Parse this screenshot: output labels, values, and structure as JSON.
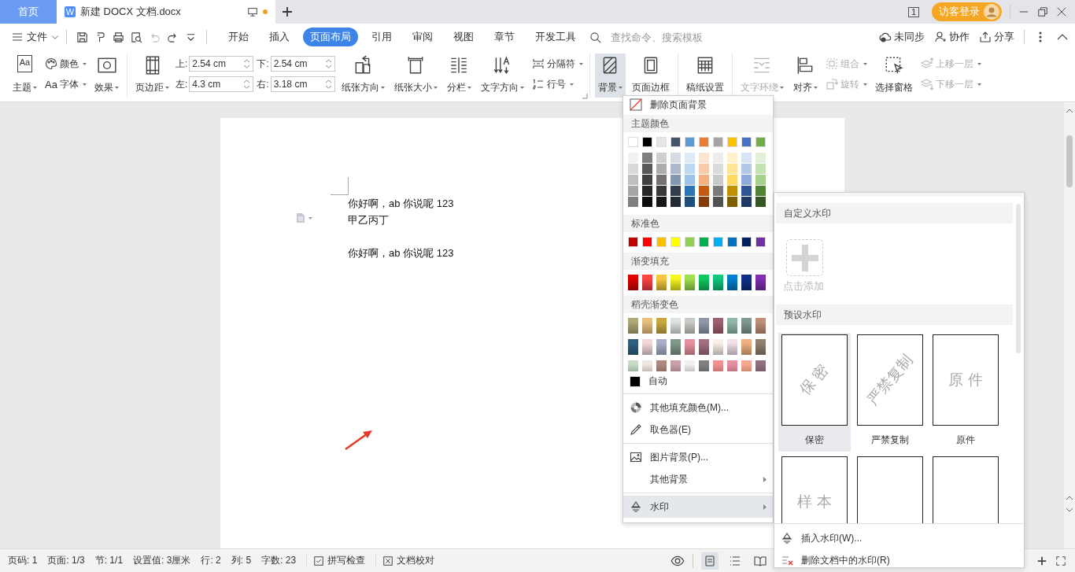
{
  "title_bar": {
    "tabs": [
      {
        "label": "首页",
        "kind": "home",
        "selected": false
      },
      {
        "label": "新建 DOCX 文档.docx",
        "kind": "document",
        "badge": "W",
        "unsaved": true,
        "selected": true
      }
    ],
    "window_count": "1",
    "login_button": "访客登录"
  },
  "menu_bar": {
    "file_menu": "文件",
    "tabs": [
      {
        "label": "开始",
        "selected": false
      },
      {
        "label": "插入",
        "selected": false
      },
      {
        "label": "页面布局",
        "selected": true
      },
      {
        "label": "引用",
        "selected": false
      },
      {
        "label": "审阅",
        "selected": false
      },
      {
        "label": "视图",
        "selected": false
      },
      {
        "label": "章节",
        "selected": false
      },
      {
        "label": "开发工具",
        "selected": false
      }
    ],
    "search": {
      "placeholder": "查找命令、搜索模板"
    },
    "actions": [
      "未同步",
      "协作",
      "分享"
    ]
  },
  "ribbon": {
    "groups": [
      [
        {
          "kind": "large",
          "items": [
            {
              "label": "主题",
              "icon_text": "Aa",
              "caret": true
            }
          ]
        },
        {
          "kind": "stack",
          "items": [
            {
              "label": "颜色",
              "caret": true
            },
            {
              "label": "字体",
              "icon_text": "Aa",
              "caret": true
            }
          ]
        },
        {
          "kind": "large",
          "items": [
            {
              "label": "效果",
              "caret": true
            }
          ]
        }
      ],
      [
        {
          "kind": "large",
          "items": [
            {
              "label": "页边距",
              "caret": true
            }
          ]
        },
        {
          "kind": "fields",
          "items": [
            {
              "label": "上:",
              "value": "2.54 cm"
            },
            {
              "label": "左:",
              "value": "4.3 cm"
            }
          ]
        },
        {
          "kind": "fields",
          "items": [
            {
              "label": "下:",
              "value": "2.54 cm"
            },
            {
              "label": "右:",
              "value": "3.18 cm"
            }
          ]
        },
        {
          "kind": "large",
          "items": [
            {
              "label": "纸张方向",
              "caret": true
            }
          ]
        },
        {
          "kind": "large",
          "items": [
            {
              "label": "纸张大小",
              "caret": true
            }
          ]
        },
        {
          "kind": "large",
          "items": [
            {
              "label": "分栏",
              "caret": true
            }
          ]
        },
        {
          "kind": "large",
          "items": [
            {
              "label": "文字方向",
              "caret": true
            }
          ]
        },
        {
          "kind": "stack",
          "items": [
            {
              "label": "分隔符",
              "caret": true
            },
            {
              "label": "行号",
              "caret": true
            }
          ]
        }
      ],
      [
        {
          "kind": "large",
          "items": [
            {
              "label": "背景",
              "caret": true,
              "selected": true
            }
          ]
        },
        {
          "kind": "large",
          "items": [
            {
              "label": "页面边框",
              "caret": false,
              "selected": false
            }
          ]
        }
      ],
      [
        {
          "kind": "large",
          "items": [
            {
              "label": "稿纸设置",
              "caret": false
            }
          ]
        }
      ],
      [
        {
          "kind": "large",
          "items": [
            {
              "label": "文字环绕",
              "caret": true,
              "disabled": true
            }
          ]
        },
        {
          "kind": "large",
          "items": [
            {
              "label": "对齐",
              "caret": true,
              "disabled": false
            }
          ]
        },
        {
          "kind": "stack",
          "items": [
            {
              "label": "组合",
              "caret": true,
              "disabled": true
            },
            {
              "label": "旋转",
              "caret": true,
              "disabled": true
            }
          ]
        },
        {
          "kind": "large",
          "items": [
            {
              "label": "选择窗格",
              "caret": false,
              "disabled": false
            }
          ]
        },
        {
          "kind": "stack",
          "items": [
            {
              "label": "上移一层",
              "caret": true,
              "disabled": true
            },
            {
              "label": "下移一层",
              "caret": true,
              "disabled": true
            }
          ]
        }
      ]
    ]
  },
  "document": {
    "blocks": [
      {
        "lines": [
          "你好啊，ab 你说呢 123",
          "甲乙丙丁"
        ]
      },
      {
        "lines": [
          "你好啊，ab 你说呢 123"
        ]
      }
    ]
  },
  "background_menu": {
    "remove": "删除页面背景",
    "theme_title": "主题颜色",
    "theme_colors": [
      {
        "color": "#ffffff",
        "shades": [
          {
            "color": "#f2f2f2"
          },
          {
            "color": "#d9d9d9"
          },
          {
            "color": "#bfbfbf"
          },
          {
            "color": "#a6a6a6"
          },
          {
            "color": "#808080"
          }
        ]
      },
      {
        "color": "#000000",
        "shades": [
          {
            "color": "#7f7f7f"
          },
          {
            "color": "#595959"
          },
          {
            "color": "#404040"
          },
          {
            "color": "#262626"
          },
          {
            "color": "#0d0d0d"
          }
        ]
      },
      {
        "color": "#e7e6e6",
        "shades": [
          {
            "color": "#d0cece"
          },
          {
            "color": "#aeabab"
          },
          {
            "color": "#757171"
          },
          {
            "color": "#3b3838"
          },
          {
            "color": "#181717"
          }
        ]
      },
      {
        "color": "#44546a",
        "shades": [
          {
            "color": "#d6dce4"
          },
          {
            "color": "#adb9ca"
          },
          {
            "color": "#8497b0"
          },
          {
            "color": "#333f4f"
          },
          {
            "color": "#222a35"
          }
        ]
      },
      {
        "color": "#5b9bd5",
        "shades": [
          {
            "color": "#deebf6"
          },
          {
            "color": "#bdd7ee"
          },
          {
            "color": "#9dc3e6"
          },
          {
            "color": "#2e75b5"
          },
          {
            "color": "#1e4e79"
          }
        ]
      },
      {
        "color": "#ed7d31",
        "shades": [
          {
            "color": "#fbe5d5"
          },
          {
            "color": "#f8cbad"
          },
          {
            "color": "#f4b183"
          },
          {
            "color": "#c55a11"
          },
          {
            "color": "#843c0c"
          }
        ]
      },
      {
        "color": "#a5a5a5",
        "shades": [
          {
            "color": "#ededed"
          },
          {
            "color": "#dbdbdb"
          },
          {
            "color": "#c9c9c9"
          },
          {
            "color": "#7b7b7b"
          },
          {
            "color": "#525252"
          }
        ]
      },
      {
        "color": "#ffc000",
        "shades": [
          {
            "color": "#fff2cc"
          },
          {
            "color": "#fee599"
          },
          {
            "color": "#ffd965"
          },
          {
            "color": "#bf9000"
          },
          {
            "color": "#7f6000"
          }
        ]
      },
      {
        "color": "#4472c4",
        "shades": [
          {
            "color": "#dae3f3"
          },
          {
            "color": "#b4c7e7"
          },
          {
            "color": "#8faadc"
          },
          {
            "color": "#2f5597"
          },
          {
            "color": "#203864"
          }
        ]
      },
      {
        "color": "#70ad47",
        "shades": [
          {
            "color": "#e2efd9"
          },
          {
            "color": "#c5e0b3"
          },
          {
            "color": "#a8d08d"
          },
          {
            "color": "#538135"
          },
          {
            "color": "#375623"
          }
        ]
      }
    ],
    "standard_title": "标准色",
    "standard_colors": [
      {
        "color": "#c00000"
      },
      {
        "color": "#ff0000"
      },
      {
        "color": "#ffc000"
      },
      {
        "color": "#ffff00"
      },
      {
        "color": "#92d050"
      },
      {
        "color": "#00b050"
      },
      {
        "color": "#00b0f0"
      },
      {
        "color": "#0070c0"
      },
      {
        "color": "#002060"
      },
      {
        "color": "#7030a0"
      }
    ],
    "gradient_title": "渐变填充",
    "gradients": [
      {
        "color": "#e00000"
      },
      {
        "color": "#ff4444"
      },
      {
        "color": "#f8c840"
      },
      {
        "color": "#f8f820"
      },
      {
        "color": "#a0e050"
      },
      {
        "color": "#10c860"
      },
      {
        "color": "#10c880"
      },
      {
        "color": "#0080d0"
      },
      {
        "color": "#103088"
      },
      {
        "color": "#8030b0"
      }
    ],
    "docer_title": "稻壳渐变色",
    "docer_gradients": [
      {
        "color": "#b0a878"
      },
      {
        "color": "#e8c080"
      },
      {
        "color": "#c8a840"
      },
      {
        "color": "#dde4e0"
      },
      {
        "color": "#c8ccc4"
      },
      {
        "color": "#9098a8"
      },
      {
        "color": "#a06070"
      },
      {
        "color": "#90b8a8"
      },
      {
        "color": "#809890"
      },
      {
        "color": "#c09078"
      },
      {
        "color": "#306080"
      },
      {
        "color": "#f0d8d8"
      },
      {
        "color": "#a8b0c8"
      },
      {
        "color": "#809888"
      },
      {
        "color": "#e890a0"
      },
      {
        "color": "#a07080"
      },
      {
        "color": "#f8f0e8"
      },
      {
        "color": "#f0e0e8"
      },
      {
        "color": "#f0b080"
      },
      {
        "color": "#908070"
      },
      {
        "color": "#c8dcc8"
      },
      {
        "color": "#f0e8e0"
      },
      {
        "color": "#b08880"
      },
      {
        "color": "#c8a0a8"
      },
      {
        "color": "#f0f0f0"
      },
      {
        "color": "#808080"
      },
      {
        "color": "#f09090"
      },
      {
        "color": "#e890a0"
      },
      {
        "color": "#f8a890"
      },
      {
        "color": "#907080"
      }
    ],
    "auto": {
      "label": "自动",
      "color": "#000000"
    },
    "items": [
      {
        "label": "其他填充颜色(M)...",
        "separator_before": true,
        "submenu": false,
        "selected": false
      },
      {
        "label": "取色器(E)",
        "separator_before": false,
        "submenu": false,
        "selected": false
      },
      {
        "label": "图片背景(P)...",
        "separator_before": true,
        "submenu": false,
        "selected": false
      },
      {
        "label": "其他背景",
        "separator_before": false,
        "submenu": true,
        "selected": false
      },
      {
        "label": "水印",
        "separator_before": true,
        "submenu": true,
        "selected": true
      }
    ]
  },
  "watermark_menu": {
    "custom_title": "自定义水印",
    "add_label": "点击添加",
    "preset_title": "预设水印",
    "presets": [
      {
        "label": "保密",
        "preview": "保 密",
        "kind": "diagonal",
        "selected": true
      },
      {
        "label": "严禁复制",
        "preview": "严禁复制",
        "kind": "diagonal",
        "selected": false
      },
      {
        "label": "原件",
        "preview": "原 件",
        "kind": "horizontal",
        "selected": false
      },
      {
        "preview": "样 本",
        "kind": "horizontal",
        "selected": false
      },
      {
        "selected": false
      },
      {
        "selected": false
      }
    ],
    "actions": [
      "插入水印(W)...",
      "删除文档中的水印(R)"
    ]
  },
  "status_bar": {
    "fields": [
      "页码: 1",
      "页面: 1/3",
      "节: 1/1",
      "设置值: 3厘米",
      "行: 2",
      "列: 5",
      "字数: 23"
    ],
    "checks": [
      "拼写检查",
      "文档校对"
    ],
    "views": [
      {
        "selected": true
      },
      {
        "selected": false
      },
      {
        "selected": false
      }
    ]
  }
}
